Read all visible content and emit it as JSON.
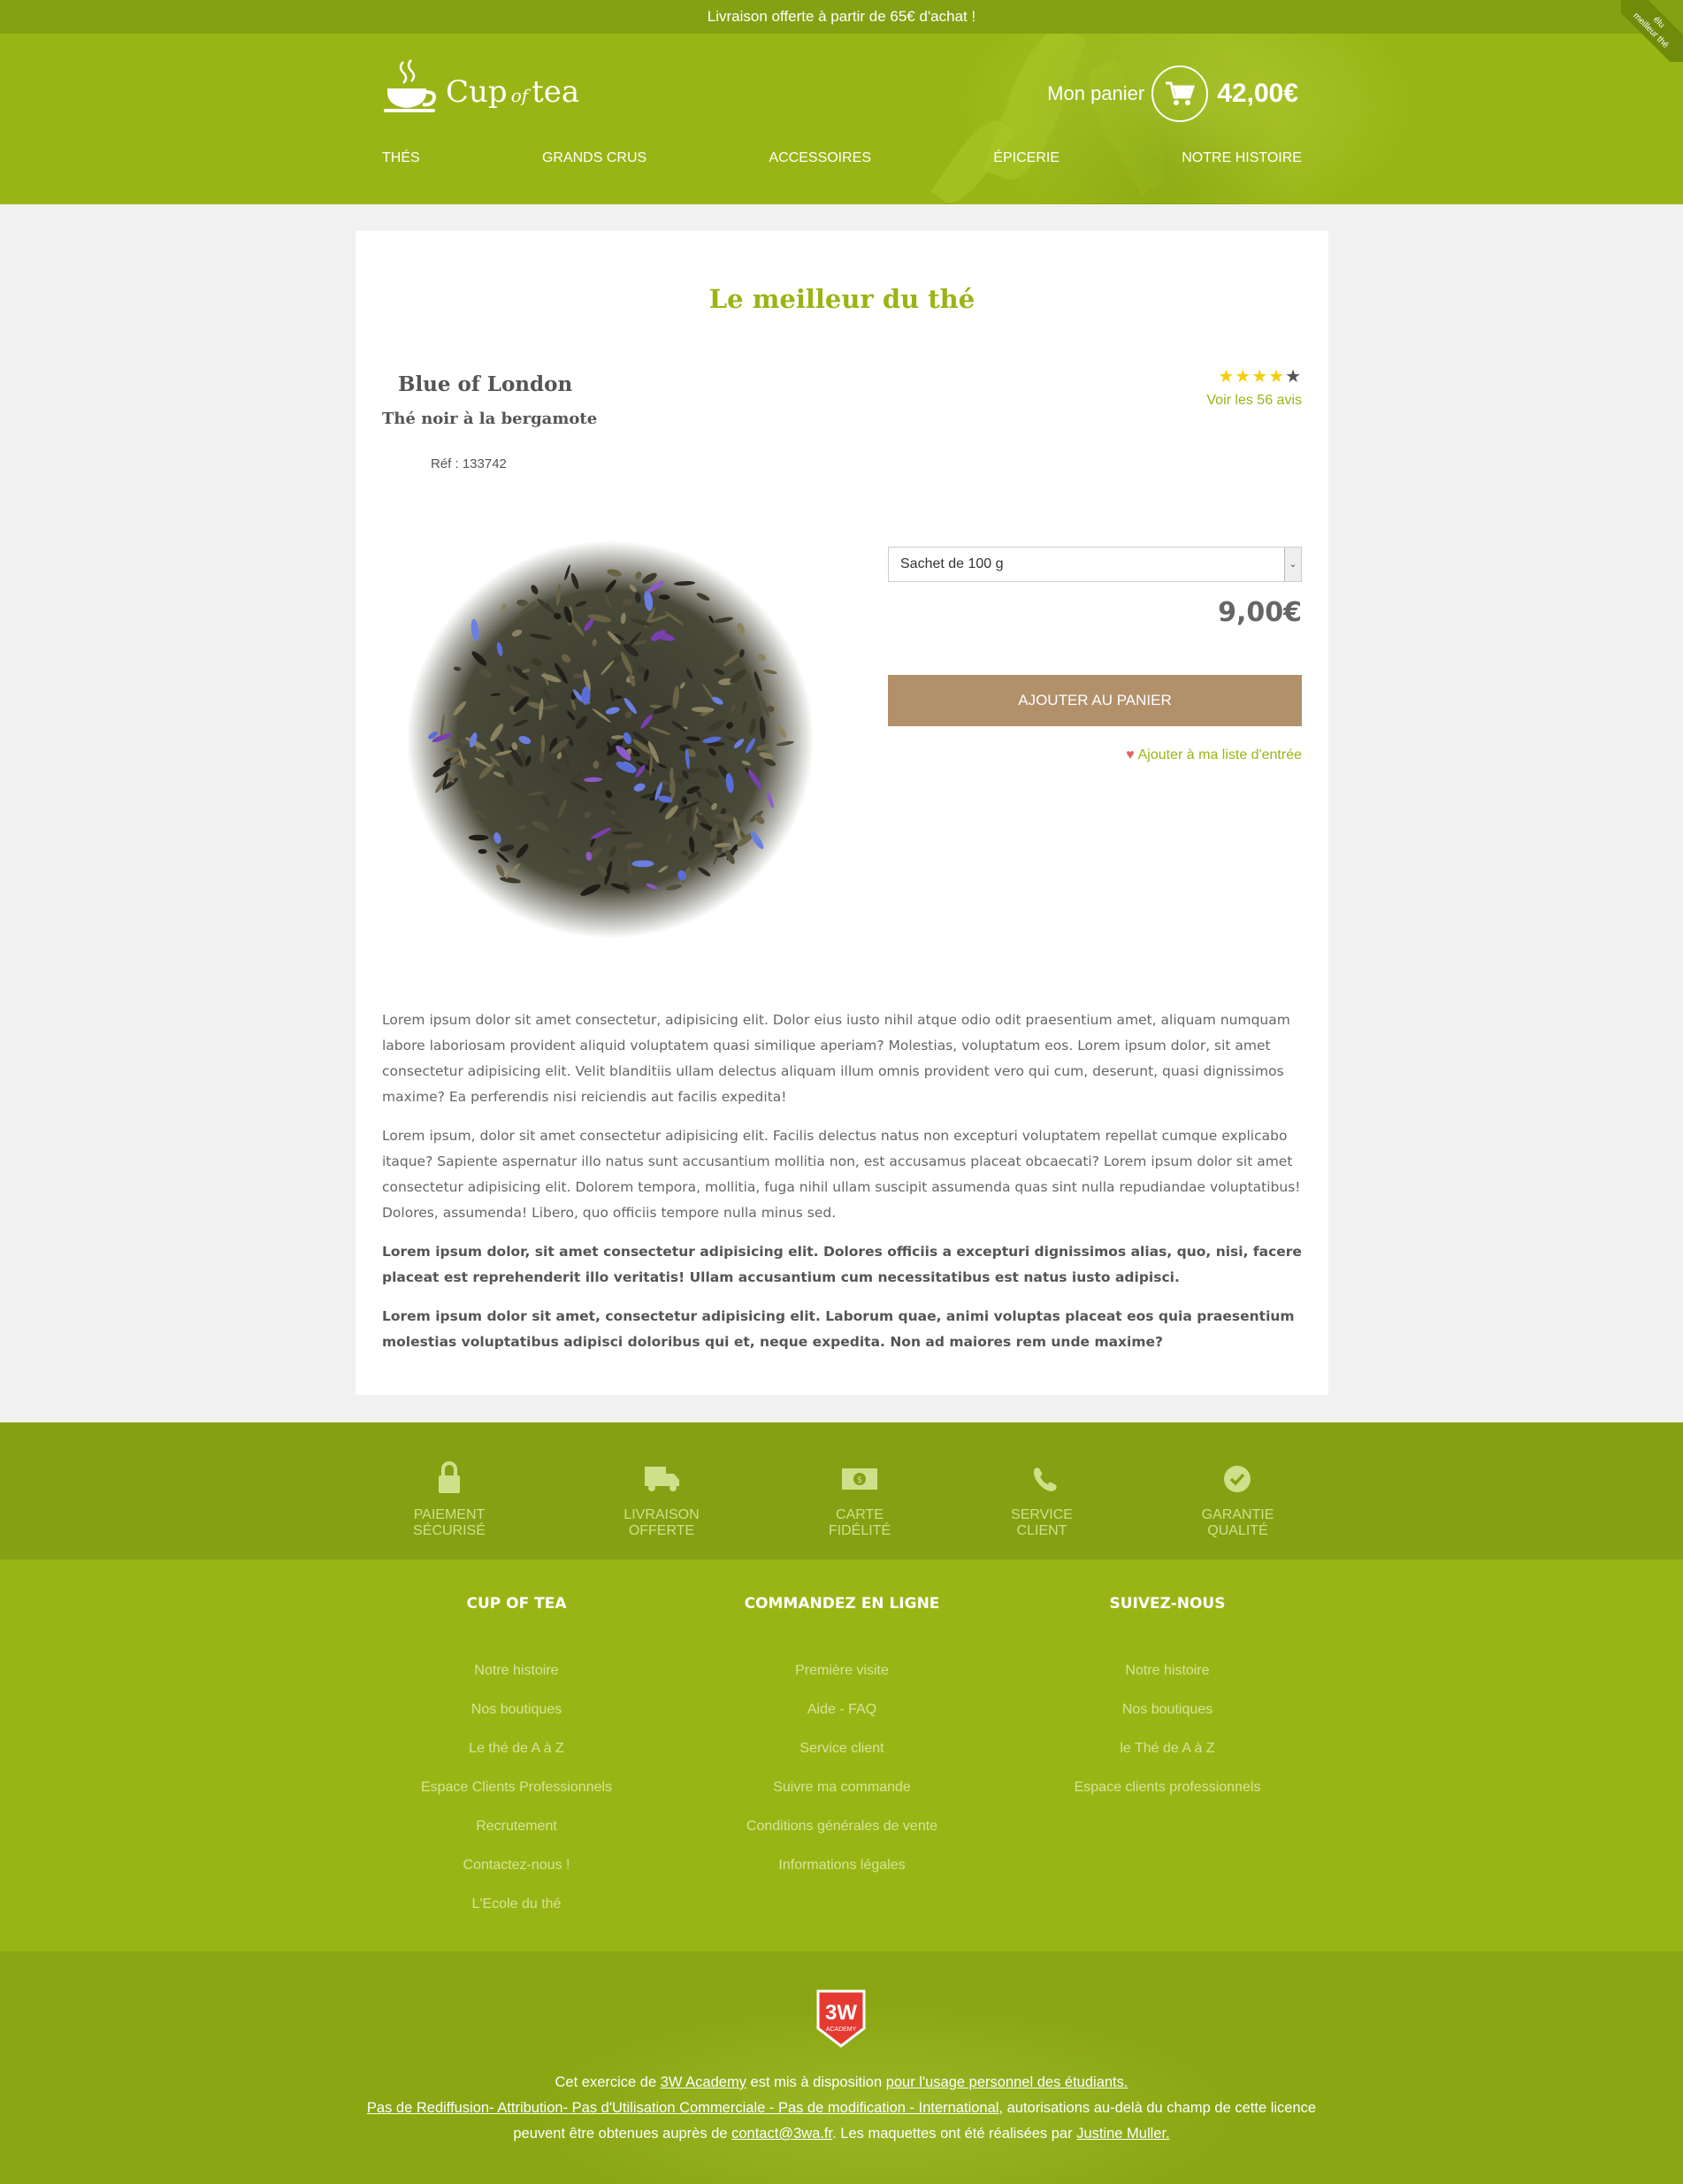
{
  "topbar": {
    "text": "Livraison offerte à partir de 65€ d'achat !"
  },
  "ribbon": {
    "line1": "élu",
    "line2": "meilleur thé"
  },
  "logo": {
    "cup": "Cup",
    "of": "of",
    "tea": "tea"
  },
  "cart": {
    "label": "Mon panier",
    "total": "42,00€",
    "icon": "cart-icon"
  },
  "nav": {
    "items": [
      "THÉS",
      "GRANDS CRUS",
      "ACCESSOIRES",
      "ÉPICERIE",
      "NOTRE HISTOIRE"
    ]
  },
  "main": {
    "section_title": "Le meilleur du thé",
    "product": {
      "name": "Blue of London",
      "subtitle": "Thé noir à la bergamote",
      "ref": "Réf : 133742",
      "rating": 4,
      "rating_max": 5,
      "reviews": "Voir les 56 avis",
      "size_selected": "Sachet de 100 g",
      "price": "9,00€",
      "add_to_cart": "AJOUTER AU PANIER",
      "wishlist": "Ajouter à ma liste d'entrée"
    },
    "description": [
      "Lorem ipsum dolor sit amet consectetur, adipisicing elit. Dolor eius iusto nihil atque odio odit praesentium amet, aliquam numquam labore laboriosam provident aliquid voluptatem quasi similique aperiam? Molestias, voluptatum eos. Lorem ipsum dolor, sit amet consectetur adipisicing elit. Velit blanditiis ullam delectus aliquam illum omnis provident vero qui cum, deserunt, quasi dignissimos maxime? Ea perferendis nisi reiciendis aut facilis expedita!",
      "Lorem ipsum, dolor sit amet consectetur adipisicing elit. Facilis delectus natus non excepturi voluptatem repellat cumque explicabo itaque? Sapiente aspernatur illo natus sunt accusantium mollitia non, est accusamus placeat obcaecati? Lorem ipsum dolor sit amet consectetur adipisicing elit. Dolorem tempora, mollitia, fuga nihil ullam suscipit assumenda quas sint nulla repudiandae voluptatibus! Dolores, assumenda! Libero, quo officiis tempore nulla minus sed.",
      "Lorem ipsum dolor, sit amet consectetur adipisicing elit. Dolores officiis a excepturi dignissimos alias, quo, nisi, facere placeat est reprehenderit illo veritatis! Ullam accusantium cum necessitatibus est natus iusto adipisci.",
      "Lorem ipsum dolor sit amet, consectetur adipisicing elit. Laborum quae, animi voluptas placeat eos quia praesentium molestias voluptatibus adipisci doloribus qui et, neque expedita. Non ad maiores rem unde maxime?"
    ]
  },
  "features": [
    {
      "label": "PAIEMENT SÉCURISÉ",
      "icon": "lock-icon"
    },
    {
      "label": "LIVRAISON OFFERTE",
      "icon": "truck-icon"
    },
    {
      "label": "CARTE FIDÉLITÉ",
      "icon": "money-icon"
    },
    {
      "label": "SERVICE CLIENT",
      "icon": "phone-icon"
    },
    {
      "label": "GARANTIE QUALITÉ",
      "icon": "check-circle-icon"
    }
  ],
  "footer": {
    "columns": [
      {
        "title": "CUP OF TEA",
        "links": [
          "Notre histoire",
          "Nos boutiques",
          "Le thé de A à Z",
          "Espace Clients Professionnels",
          "Recrutement",
          "Contactez-nous !",
          "L'Ecole du thé"
        ]
      },
      {
        "title": "COMMANDEZ EN LIGNE",
        "links": [
          "Première visite",
          "Aide - FAQ",
          "Service client",
          "Suivre ma commande",
          "Conditions générales de vente",
          "Informations légales"
        ]
      },
      {
        "title": "SUIVEZ-NOUS",
        "links": [
          "Notre histoire",
          "Nos boutiques",
          "le Thé de A à Z",
          "Espace clients professionnels"
        ]
      }
    ]
  },
  "credits": {
    "badge_main": "3W",
    "badge_sub": "ACADEMY",
    "l1_a": "Cet exercice de ",
    "l1_link1": "3W Academy",
    "l1_b": " est mis à disposition ",
    "l1_link2": "pour l'usage personnel des étudiants.",
    "l2_link": "Pas de Rediffusion- Attribution- Pas d'Utilisation Commerciale - Pas de modification - International,",
    "l2_b": " autorisations au-delà du champ de cette licence",
    "l3_a": "peuvent être obtenues auprès de ",
    "l3_link1": "contact@3wa.fr",
    "l3_b": ". Les maquettes ont été réalisées par ",
    "l3_link2": "Justine Muller."
  },
  "colors": {
    "green": "#99b515",
    "dark_green": "#86a013",
    "button": "#b1906a",
    "star": "#f5cd0a",
    "heart": "#e86060"
  }
}
